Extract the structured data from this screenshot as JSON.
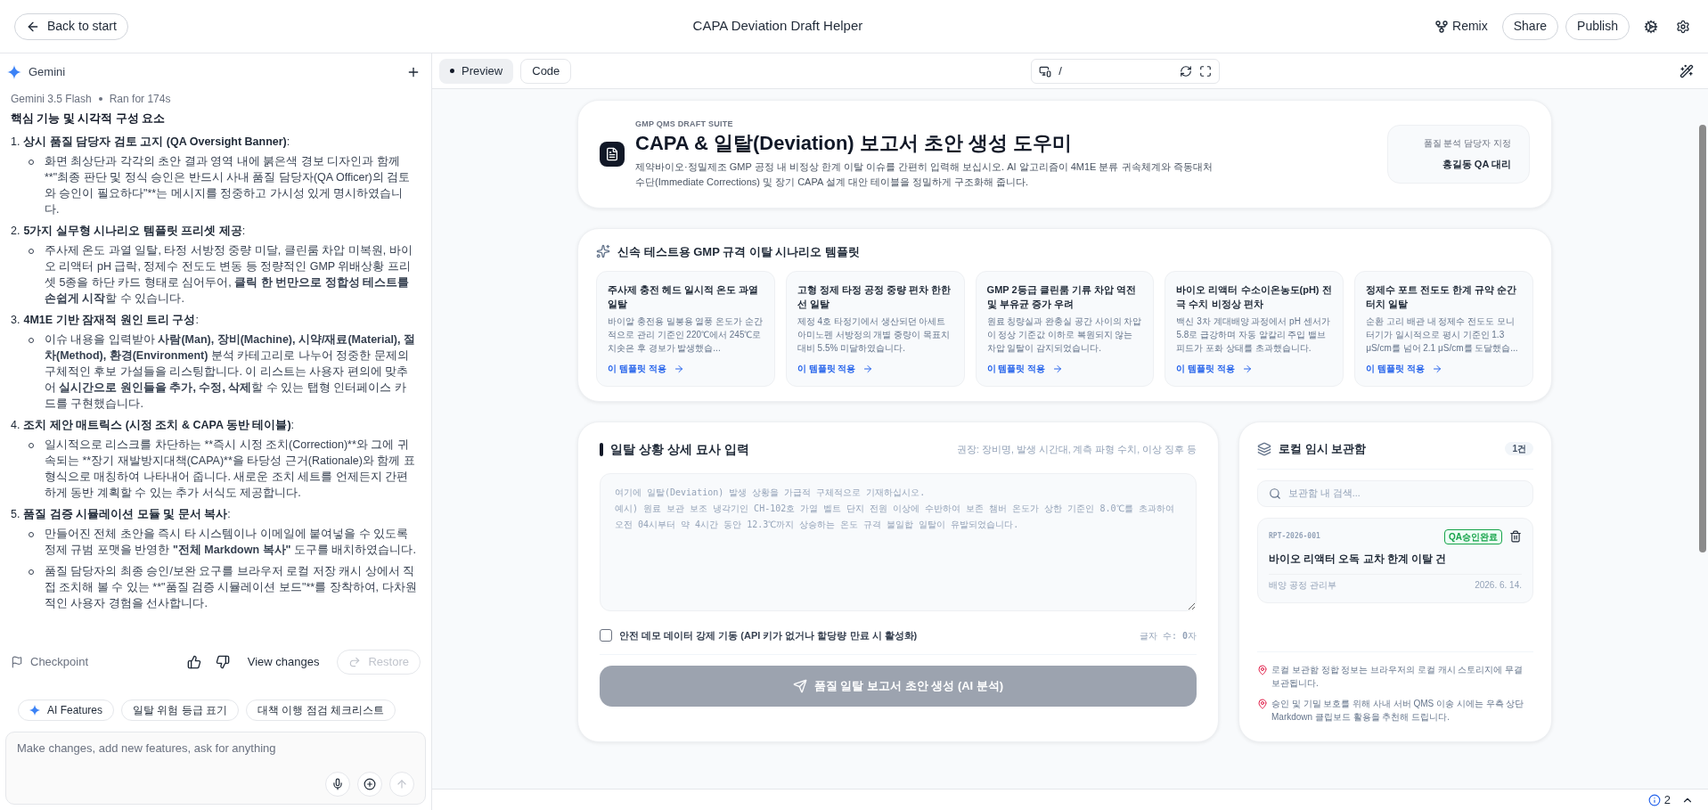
{
  "top_bar": {
    "back_button": "Back to start",
    "title": "CAPA Deviation Draft Helper",
    "actions": [
      {
        "label": "Remix",
        "kind": "remix"
      },
      {
        "label": "Share",
        "kind": "outline"
      },
      {
        "label": "Publish",
        "kind": "outline"
      }
    ]
  },
  "chat": {
    "title": "Gemini",
    "model": "Gemini 3.5 Flash",
    "run_info": "Ran for 174s",
    "heading": "핵심 기능 및 시각적 구성 요소",
    "sections": [
      {
        "number": "1.",
        "title": "**상시 품질 담당자 검토 고지 (QA Oversight Banner)**:",
        "bullets": [
          {
            "text": "화면 최상단과 각각의 초안 결과 영역 내에 붉은색 경보 디자인과 함께 **\"최종 판단 및 정식 승인은 반드시 사내 품질 담당자(QA Officer)의 검토와 승인이 필요하다\"**는 메시지를 정중하고 가시성 있게 명시하였습니다.",
            "markup": false
          }
        ]
      },
      {
        "number": "2.",
        "title": "**5가지 실무형 시나리오 템플릿 프리셋 제공**:",
        "bullets": [
          {
            "text": "주사제 온도 과열 일탈, 타정 서방정 중량 미달, 클린룸 차압 미복원, 바이오 리액터 pH 급락, 정제수 전도도 변동 등 정량적인 GMP 위배상황 프리셋 5종을 하단 카드 형태로 심어두어, **클릭 한 번만으로 정합성 테스트를 손쉽게 시작**할 수 있습니다.",
            "markup": true
          }
        ]
      },
      {
        "number": "3.",
        "title": "**4M1E 기반 잠재적 원인 트리 구성**:",
        "bullets": [
          {
            "text": "이슈 내용을 입력받아 **사람(Man), 장비(Machine), 시약/재료(Material), 절차(Method), 환경(Environment)** 분석 카테고리로 나누어 정중한 문제의 구체적인 후보 가설들을 리스팅합니다. 이 리스트는 사용자 편의에 맞추어 **실시간으로 원인들을 추가, 수정, 삭제**할 수 있는 탭형 인터페이스 카드를 구현했습니다.",
            "markup": true
          }
        ]
      },
      {
        "number": "4.",
        "title": "**조치 제안 매트릭스 (시정 조치 & CAPA 동반 테이블)**:",
        "bullets": [
          {
            "text": "일시적으로 리스크를 차단하는 **즉시 시정 조치(Correction)**와 그에 귀속되는 **장기 재발방지대책(CAPA)**을 타당성 근거(Rationale)와 함께 표 형식으로 매칭하여 나타내어 줍니다. 새로운 조치 세트를 언제든지 간편하게 동반 계획할 수 있는 추가 서식도 제공합니다.",
            "markup": false
          }
        ]
      },
      {
        "number": "5.",
        "title": "**품질 검증 시뮬레이션 모듈 및 문서 복사**:",
        "bullets": [
          {
            "text": "만들어진 전체 초안을 즉시 타 시스템이나 이메일에 붙여넣을 수 있도록 정제 규범 포맷을 반영한 **\"전체 Markdown 복사\"** 도구를 배치하였습니다.",
            "markup": true
          },
          {
            "text": "품질 담당자의 최종 승인/보완 요구를 브라우저 로컬 저장 캐시 상에서 직접 조치해 볼 수 있는 **\"품질 검증 시뮬레이션 보드\"**를 장착하여, 다차원적인 사용자 경험을 선사합니다.",
            "markup": false
          }
        ]
      }
    ],
    "checkpoint": "Checkpoint",
    "view_changes": "View changes",
    "restore": {
      "label": "Restore",
      "disabled": true
    },
    "chips": [
      {
        "label": "AI Features",
        "kind": "ai"
      },
      {
        "label": "일탈 위험 등급 표기",
        "kind": "plain"
      },
      {
        "label": "대책 이행 점검 체크리스트",
        "kind": "plain"
      }
    ],
    "input": {
      "placeholder": "Make changes, add new features, ask for anything"
    }
  },
  "preview": {
    "tabs": [
      {
        "label": "Preview",
        "selected": true
      },
      {
        "label": "Code",
        "selected": false
      }
    ],
    "address": "/",
    "header": {
      "eyebrow": "GMP QMS DRAFT SUITE",
      "title": "CAPA & 일탈(Deviation) 보고서 초안 생성 도우미",
      "description": "제약바이오·정밀제조 GMP 공정 내 비정상 한계 이탈 이슈를 간편히 입력해 보십시오. AI 알고리즘이 4M1E 분류 귀속체계와 즉동대처 수단(Immediate Corrections) 및 장기 CAPA 설계 대안 테이블을 정밀하게 구조화해 줍니다.",
      "assignee_label": "품질 분석 담당자 지정",
      "assignee": "홍길동 QA 대리"
    },
    "templates": {
      "title": "신속 테스트용 GMP 규격 이탈 시나리오 템플릿",
      "items": [
        {
          "title": "주사제 충전 헤드 일시적 온도 과열 일탈",
          "description": "바이알 충전용 밀봉용 열풍 온도가 순간적으로 관리 기준인 220℃에서 245℃로 치솟은 후 경보가 발생했습...",
          "link": "이 템플릿 적용"
        },
        {
          "title": "고형 정제 타정 공정 중량 편차 한한선 일탈",
          "description": "제정 4호 타정기에서 생산되던 아세트아미노펜 서방정의 개별 중량이 목표치 대비 5.5% 미달하였습니다.",
          "link": "이 템플릿 적용"
        },
        {
          "title": "GMP 2등급 클린룸 기류 차압 역전 및 부유균 증가 우려",
          "description": "원료 칭량실과 완충실 공간 사이의 차압이 정상 기준값 이하로 복원되지 않는 차압 일탈이 감지되었습니다.",
          "link": "이 템플릿 적용"
        },
        {
          "title": "바이오 리액터 수소이온농도(pH) 전극 수치 비정상 편차",
          "description": "백신 3차 계대배양 과정에서 pH 센서가 5.8로 급강하며 자동 알칼리 주입 밸브 피드가 포화 상태를 초과했습니다.",
          "link": "이 템플릿 적용"
        },
        {
          "title": "정제수 포트 전도도 한계 규약 순간 터치 일탈",
          "description": "순환 고리 배관 내 정제수 전도도 모니터기가 일시적으로 평시 기준인 1.3 μS/cm를 넘어 2.1 μS/cm를 도달했습...",
          "link": "이 템플릿 적용"
        }
      ]
    },
    "input_card": {
      "title": "일탈 상황 상세 묘사 입력",
      "hint": "권장: 장비명, 발생 시간대, 계측 파형 수치, 이상 징후 등",
      "placeholder": "여기에 일탈(Deviation) 발생 상황을 가급적 구체적으로 기재하십시오.\n예시) 원료 보관 보조 냉각기인 CH-102호 가열 벨트 단지 전원 이상에 수반하여 보존 챔버 온도가 상한 기준인 8.0℃를 초과하여 오전 04시부터 약 4시간 동안 12.3℃까지 상승하는 온도 규격 불일합 일탈이 유발되었습니다.",
      "demo": {
        "label": "안전 데모 데이터 강제 기동 (API 키가 없거나 할당량 만료 시 활성화)",
        "checked": false
      },
      "char_count": "글자 수: **0**자",
      "submit": {
        "label": "품질 일탈 보고서 초안 생성 (AI 분석)",
        "disabled": true
      }
    },
    "storage": {
      "title": "로컬 임시 보관함",
      "count": "1건",
      "search_placeholder": "보관함 내 검색...",
      "items": [
        {
          "id": "RPT-2026-001",
          "status": "QA승인완료",
          "color": "#16a34a",
          "title": "바이오 리액터 오독 교차 한계 이탈 건",
          "department": "배양 공정 관리부",
          "date": "2026. 6. 14."
        }
      ],
      "notes": [
        "로컬 보관함 정합 정보는 브라우저의 로컬 캐시 스토리지에 무결 보관됩니다.",
        "승인 및 기밀 보호를 위해 사내 서버 QMS 이송 시에는 우측 상단 Markdown 클립보드 활용을 추천해 드립니다."
      ]
    }
  },
  "status_bar": {
    "count": "2"
  }
}
